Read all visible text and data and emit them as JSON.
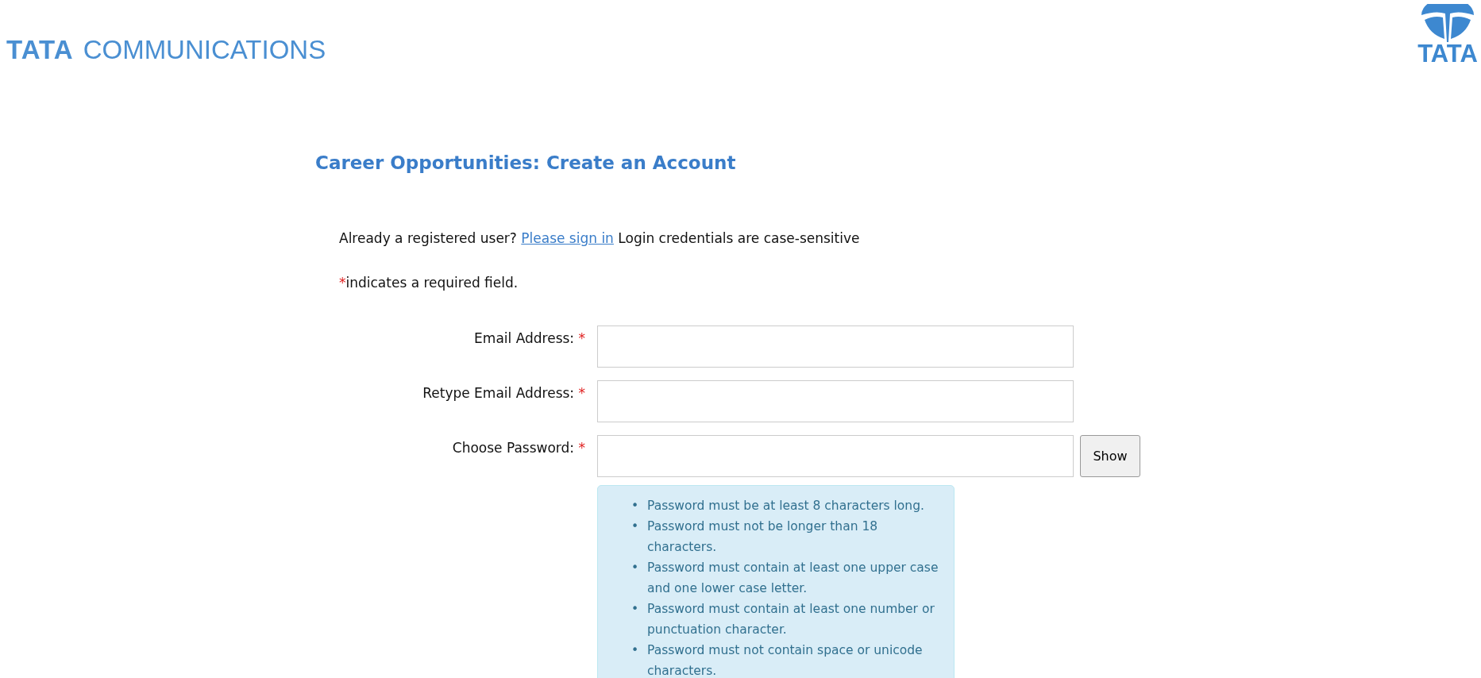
{
  "header": {
    "logo_left": {
      "brand": "TATA",
      "text": "COMMUNICATIONS"
    },
    "logo_right": {
      "text": "TATA"
    }
  },
  "heading": "Career Opportunities: Create an Account",
  "intro": {
    "before": "Already a registered user?",
    "link": "Please sign in",
    "after": "Login credentials are case-sensitive"
  },
  "required_note": {
    "mark": "*",
    "text": "indicates a required field."
  },
  "fields": [
    {
      "label": "Email Address:",
      "mark": "*",
      "kind": "text"
    },
    {
      "label": "Retype Email Address:",
      "mark": "*",
      "kind": "text"
    },
    {
      "label": "Choose Password:",
      "mark": "*",
      "kind": "password",
      "button": "Show"
    }
  ],
  "password_rules": [
    {
      "bullet": "•",
      "text": "Password must be at least 8 characters long."
    },
    {
      "bullet": "•",
      "text": "Password must not be longer than 18 characters."
    },
    {
      "bullet": "•",
      "text": "Password must contain at least one upper case and one lower case letter."
    },
    {
      "bullet": "•",
      "text": "Password must contain at least one number or punctuation character."
    },
    {
      "bullet": "•",
      "text": "Password must not contain space or unicode characters."
    }
  ]
}
